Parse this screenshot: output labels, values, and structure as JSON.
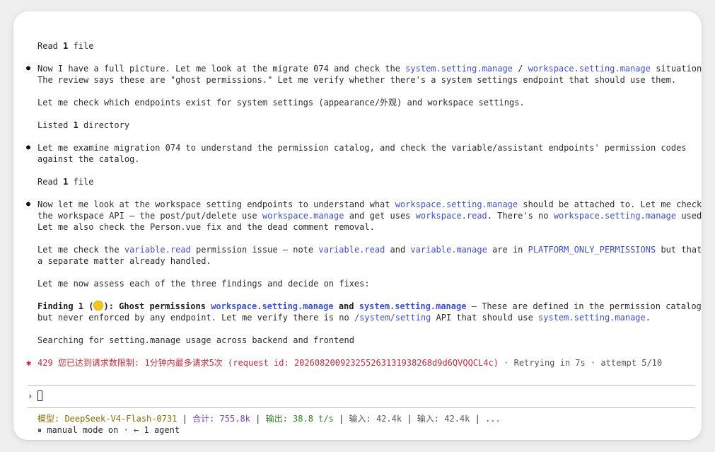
{
  "log": {
    "read1": [
      "Read ",
      "1",
      " file"
    ],
    "p1_line1": [
      "Now I have a full picture. Let me look at the migrate 074 and check the ",
      "system.setting.manage",
      " / ",
      "workspace.setting.manage",
      " situation."
    ],
    "p1_line2": "The review says these are \"ghost permissions.\" Let me verify whether there's a system settings endpoint that should use them.",
    "p1_line3": "Let me check which endpoints exist for system settings (appearance/外观) and workspace settings.",
    "listed": [
      "Listed ",
      "1",
      " directory"
    ],
    "p2_line1": "Let me examine migration 074 to understand the permission catalog, and check the variable/assistant endpoints' permission codes",
    "p2_line2": "against the catalog.",
    "read2": [
      "Read ",
      "1",
      " file"
    ],
    "p3_line1": [
      "Now let me look at the workspace setting endpoints to understand what ",
      "workspace.setting.manage",
      " should be attached to. Let me check"
    ],
    "p3_line2": [
      "the workspace API — the post/put/delete use ",
      "workspace.manage",
      " and get uses ",
      "workspace.read",
      ". There's no ",
      "workspace.setting.manage",
      " used."
    ],
    "p3_line3": "Let me also check the Person.vue fix and the dead comment removal.",
    "p4_line1": [
      "Let me check the ",
      "variable.read",
      " permission issue — note ",
      "variable.read",
      " and ",
      "variable.manage",
      " are in ",
      "PLATFORM_ONLY_PERMISSIONS",
      " but that's"
    ],
    "p4_line2": "a separate matter already handled.",
    "p5": "Let me now assess each of the three findings and decide on fixes:",
    "finding_line1": [
      "Finding 1 (",
      "): Ghost permissions ",
      "workspace.setting.manage",
      " and ",
      "system.setting.manage",
      " — These are defined in the permission catalog"
    ],
    "finding_line2": [
      "but never enforced by any endpoint. Let me verify there is no ",
      "/system/setting",
      " API that should use ",
      "system.setting.manage",
      "."
    ],
    "searching": "Searching for setting.manage usage across backend and frontend",
    "error": [
      "429 您已达到请求数限制: 1分钟内最多请求5次 (request id: 2026082009232552631319382​68d9d6QVQQCL4c)",
      " · Retrying in 7s · attempt 5/10"
    ]
  },
  "prompt": {
    "symbol": "›"
  },
  "status": {
    "model": "模型: DeepSeek-V4-Flash-0731",
    "total": "合计: 755.8k",
    "output": "输出: 38.8 t/s",
    "input1": "输入: 42.4k",
    "input2": "输入: 42.4k",
    "more": "...",
    "sep": " | ",
    "mode": "⏸ manual mode on · ← 1 agent"
  },
  "colors": {
    "code": "#3d4fd6",
    "error": "#c72b3b",
    "olive": "#8a6d00",
    "purple": "#7a3fb5",
    "green": "#2f7d1f"
  },
  "icons": {
    "bullet": "●",
    "error_marker": "✱",
    "finding_emoji": "yellow-circle"
  }
}
